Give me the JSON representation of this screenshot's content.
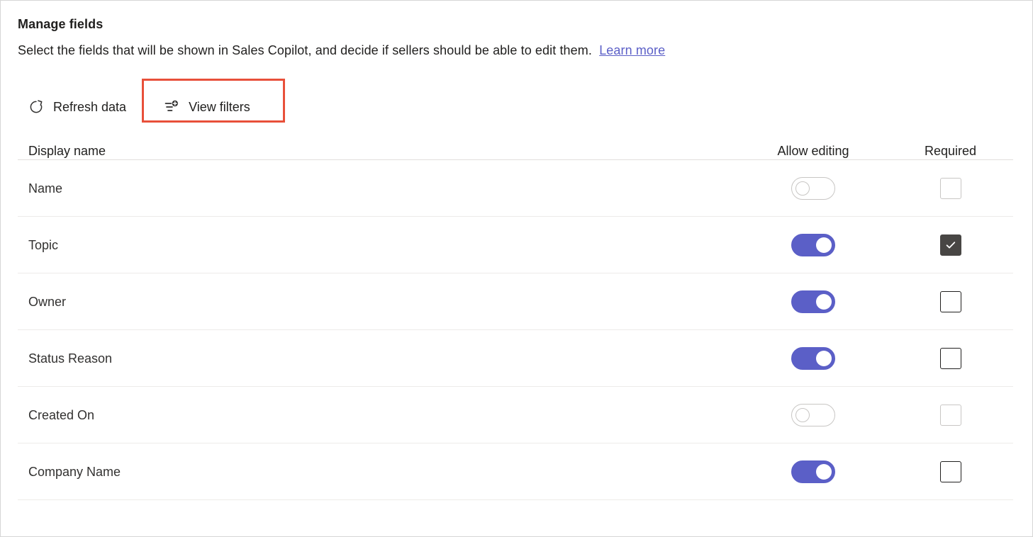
{
  "page": {
    "title": "Manage fields",
    "subtitle_text": "Select the fields that will be shown in Sales Copilot, and decide if sellers should be able to edit them.",
    "learn_more_label": "Learn more"
  },
  "command_bar": {
    "refresh_label": "Refresh data",
    "refresh_icon": "refresh-icon",
    "view_filters_label": "View filters",
    "view_filters_icon": "filter-add-icon",
    "highlight_color": "#e8503a"
  },
  "table": {
    "headers": {
      "display_name": "Display name",
      "allow_editing": "Allow editing",
      "required": "Required"
    },
    "rows": [
      {
        "display_name": "Name",
        "allow_editing": "off",
        "editing_disabled": true,
        "required": "unchecked",
        "required_disabled": true
      },
      {
        "display_name": "Topic",
        "allow_editing": "on",
        "editing_disabled": false,
        "required": "checked",
        "required_disabled": false
      },
      {
        "display_name": "Owner",
        "allow_editing": "on",
        "editing_disabled": false,
        "required": "unchecked",
        "required_disabled": false
      },
      {
        "display_name": "Status Reason",
        "allow_editing": "on",
        "editing_disabled": false,
        "required": "unchecked",
        "required_disabled": false
      },
      {
        "display_name": "Created On",
        "allow_editing": "off",
        "editing_disabled": true,
        "required": "unchecked",
        "required_disabled": true
      },
      {
        "display_name": "Company Name",
        "allow_editing": "on",
        "editing_disabled": false,
        "required": "unchecked",
        "required_disabled": false
      }
    ]
  },
  "colors": {
    "toggle_on": "#5b5fc7",
    "toggle_off_border": "#c8c6c4",
    "checkbox_checked": "#484644",
    "link": "#5b5fc7",
    "text": "#201f1e",
    "row_divider": "#edebe9"
  }
}
